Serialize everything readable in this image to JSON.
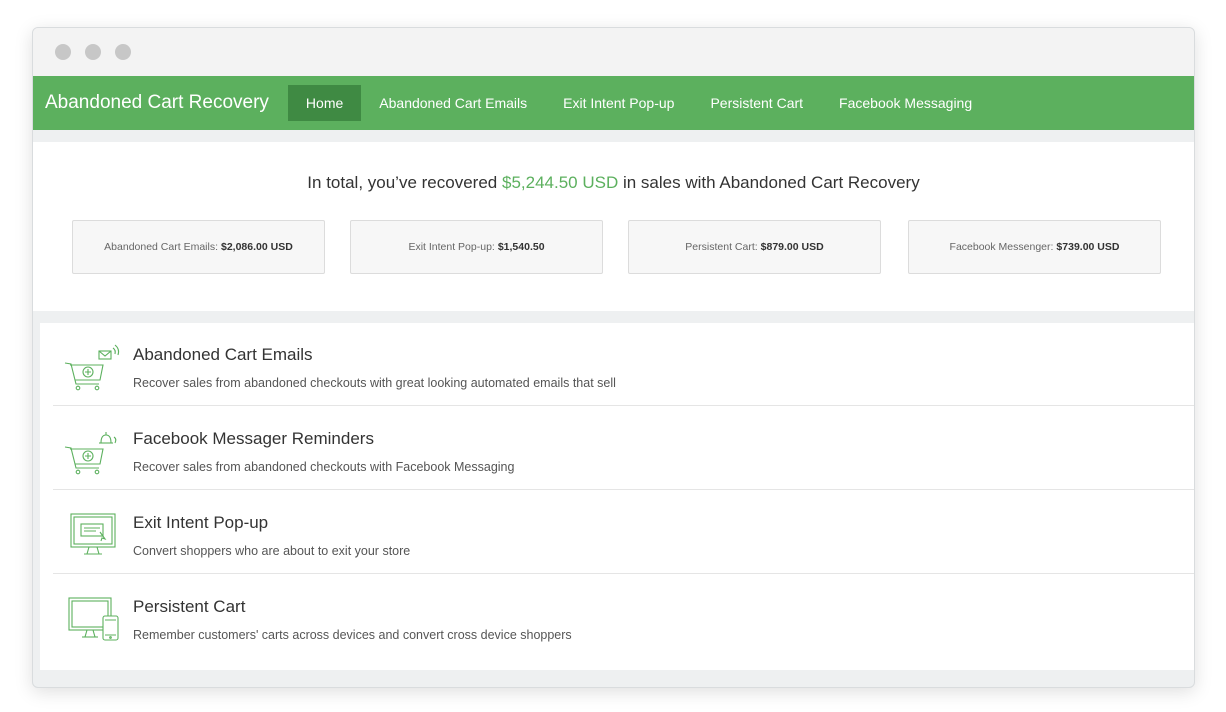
{
  "navbar": {
    "brand": "Abandoned Cart Recovery",
    "items": [
      {
        "label": "Home",
        "active": true
      },
      {
        "label": "Abandoned Cart Emails",
        "active": false
      },
      {
        "label": "Exit Intent Pop-up",
        "active": false
      },
      {
        "label": "Persistent Cart",
        "active": false
      },
      {
        "label": "Facebook Messaging",
        "active": false
      }
    ]
  },
  "summary": {
    "prefix": "In total, you’ve recovered",
    "amount": "$5,244.50 USD",
    "suffix": "in sales with Abandoned Cart Recovery",
    "stats": [
      {
        "label": "Abandoned Cart Emails:",
        "value": "$2,086.00 USD"
      },
      {
        "label": "Exit Intent Pop-up:",
        "value": "$1,540.50"
      },
      {
        "label": "Persistent Cart:",
        "value": "$879.00 USD"
      },
      {
        "label": "Facebook Messenger:",
        "value": "$739.00 USD"
      }
    ]
  },
  "features": [
    {
      "icon": "cart-email-icon",
      "title": "Abandoned Cart Emails",
      "description": "Recover sales from abandoned checkouts with great looking automated emails that sell"
    },
    {
      "icon": "cart-bell-icon",
      "title": "Facebook Messager Reminders",
      "description": "Recover sales from abandoned checkouts with Facebook Messaging"
    },
    {
      "icon": "monitor-popup-icon",
      "title": "Exit Intent Pop-up",
      "description": "Convert shoppers who are about to exit your store"
    },
    {
      "icon": "devices-icon",
      "title": "Persistent Cart",
      "description": "Remember customers' carts across devices and convert cross device shoppers"
    }
  ],
  "colors": {
    "accent": "#5cb05e",
    "accent_dark": "#3f8a43"
  }
}
